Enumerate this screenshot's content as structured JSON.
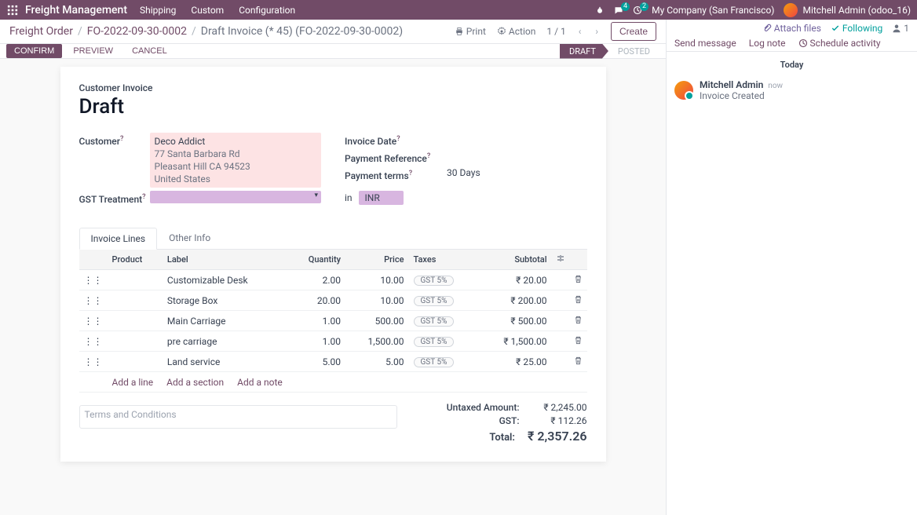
{
  "topbar": {
    "brand": "Freight Management",
    "menu": [
      "Shipping",
      "Custom",
      "Configuration"
    ],
    "msgBadge": "4",
    "clockBadge": "2",
    "company": "My Company (San Francisco)",
    "user": "Mitchell Admin (odoo_16)"
  },
  "breadcrumb": {
    "a": "Freight Order",
    "b": "FO-2022-09-30-0002",
    "c": "Draft Invoice (* 45) (FO-2022-09-30-0002)"
  },
  "controls": {
    "print": "Print",
    "action": "Action",
    "pager": "1 / 1",
    "create": "Create",
    "confirm": "CONFIRM",
    "preview": "PREVIEW",
    "cancel": "CANCEL",
    "draft": "DRAFT",
    "posted": "POSTED"
  },
  "form": {
    "titleSmall": "Customer Invoice",
    "titleBig": "Draft",
    "labels": {
      "customer": "Customer",
      "gst": "GST Treatment",
      "invDate": "Invoice Date",
      "payRef": "Payment Reference",
      "payTerms": "Payment terms",
      "in": "in"
    },
    "customer": {
      "name": "Deco Addict",
      "line1": "77 Santa Barbara Rd",
      "line2": "Pleasant Hill CA 94523",
      "line3": "United States"
    },
    "paymentTerms": "30 Days",
    "currency": "INR"
  },
  "tabs": {
    "lines": "Invoice Lines",
    "other": "Other Info"
  },
  "table": {
    "headers": {
      "product": "Product",
      "label": "Label",
      "qty": "Quantity",
      "price": "Price",
      "taxes": "Taxes",
      "subtotal": "Subtotal"
    },
    "rows": [
      {
        "label": "Customizable Desk",
        "qty": "2.00",
        "price": "10.00",
        "tax": "GST 5%",
        "sub": "₹ 20.00"
      },
      {
        "label": "Storage Box",
        "qty": "20.00",
        "price": "10.00",
        "tax": "GST 5%",
        "sub": "₹ 200.00"
      },
      {
        "label": "Main Carriage",
        "qty": "1.00",
        "price": "500.00",
        "tax": "GST 5%",
        "sub": "₹ 500.00"
      },
      {
        "label": "pre carriage",
        "qty": "1.00",
        "price": "1,500.00",
        "tax": "GST 5%",
        "sub": "₹ 1,500.00"
      },
      {
        "label": "Land service",
        "qty": "5.00",
        "price": "5.00",
        "tax": "GST 5%",
        "sub": "₹ 25.00"
      }
    ],
    "add": {
      "line": "Add a line",
      "section": "Add a section",
      "note": "Add a note"
    }
  },
  "terms": {
    "placeholder": "Terms and Conditions"
  },
  "totals": {
    "untaxedLbl": "Untaxed Amount:",
    "untaxed": "₹ 2,245.00",
    "gstLbl": "GST:",
    "gst": "₹ 112.26",
    "totalLbl": "Total:",
    "total": "₹ 2,357.26"
  },
  "chat": {
    "attach": "Attach files",
    "following": "Following",
    "followers": "1",
    "send": "Send message",
    "log": "Log note",
    "schedule": "Schedule activity",
    "today": "Today",
    "msg": {
      "author": "Mitchell Admin",
      "time": "now",
      "body": "Invoice Created"
    }
  }
}
